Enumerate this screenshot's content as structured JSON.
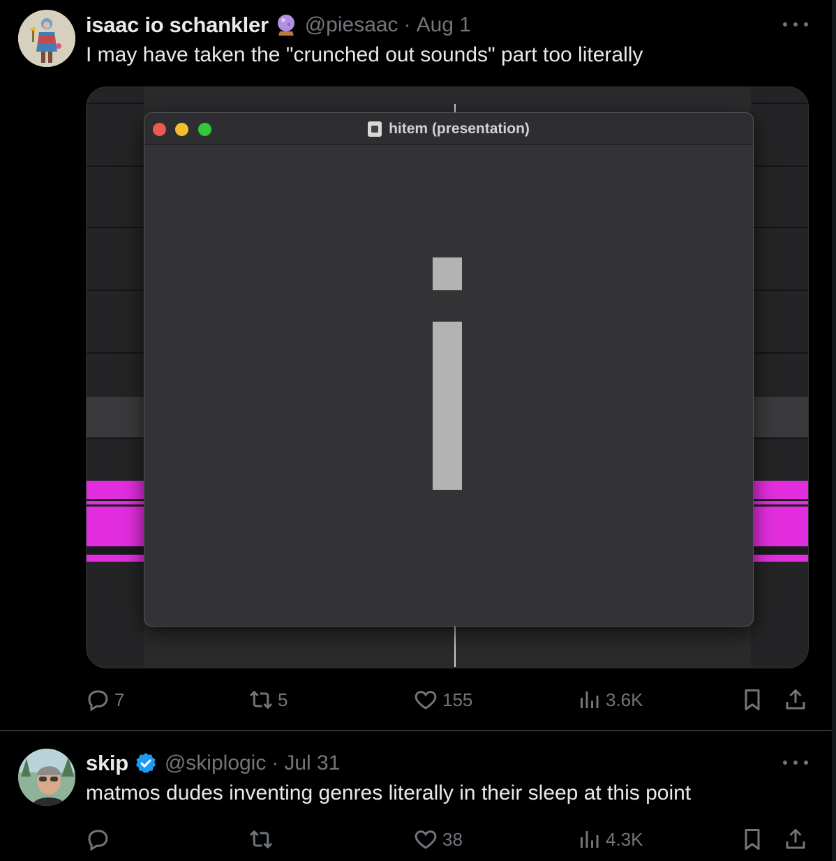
{
  "tweets": [
    {
      "author": {
        "name": "isaac io schankler",
        "handle": "@piesaac",
        "badge": "crystal-ball-emoji"
      },
      "date": "Aug 1",
      "separator": "·",
      "text": "I may have taken the \"crunched out sounds\" part too literally",
      "media": {
        "window_title": "hitem (presentation)",
        "highlight_color": "#e22ede"
      },
      "actions": {
        "replies": "7",
        "retweets": "5",
        "likes": "155",
        "views": "3.6K"
      }
    },
    {
      "author": {
        "name": "skip",
        "handle": "@skiplogic",
        "badge": "verified-badge"
      },
      "date": "Jul 31",
      "separator": "·",
      "text": "matmos dudes inventing genres literally in their sleep at this point",
      "actions": {
        "replies": "",
        "retweets": "",
        "likes": "38",
        "views": "4.3K"
      }
    }
  ],
  "colors": {
    "background": "#000000",
    "text_primary": "#e7e9ea",
    "text_secondary": "#71767b",
    "verified_blue": "#1d9bf0",
    "divider": "#2f3336"
  }
}
